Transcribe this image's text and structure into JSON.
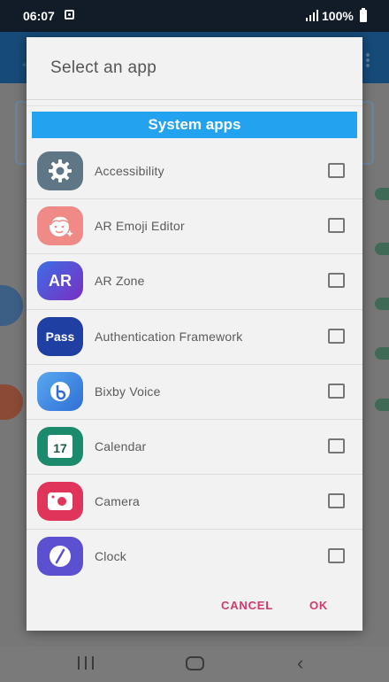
{
  "status_bar": {
    "time": "06:07",
    "battery": "100%"
  },
  "dialog": {
    "title": "Select an app",
    "section_header": "System apps",
    "apps": [
      {
        "label": "Accessibility",
        "icon": "accessibility-gear-icon",
        "icon_bg": "#5f7686"
      },
      {
        "label": "AR Emoji Editor",
        "icon": "ar-emoji-face-icon",
        "icon_bg": "#ef8a86"
      },
      {
        "label": "AR Zone",
        "icon": "ar-zone-icon",
        "icon_text": "AR",
        "icon_bg": "#5b3cc4"
      },
      {
        "label": "Authentication Framework",
        "icon": "pass-icon",
        "icon_text": "Pass",
        "icon_bg": "#1f3fa3"
      },
      {
        "label": "Bixby Voice",
        "icon": "bixby-icon",
        "icon_bg": "#3f8ee6"
      },
      {
        "label": "Calendar",
        "icon": "calendar-icon",
        "icon_text": "17",
        "icon_bg": "#1b8a6d"
      },
      {
        "label": "Camera",
        "icon": "camera-icon",
        "icon_bg": "#e0345a"
      },
      {
        "label": "Clock",
        "icon": "clock-icon",
        "icon_bg": "#5b50d0"
      }
    ],
    "cancel_label": "CANCEL",
    "ok_label": "OK"
  },
  "colors": {
    "section_header_bg": "#22a2ef",
    "button_text": "#d03a6e"
  }
}
